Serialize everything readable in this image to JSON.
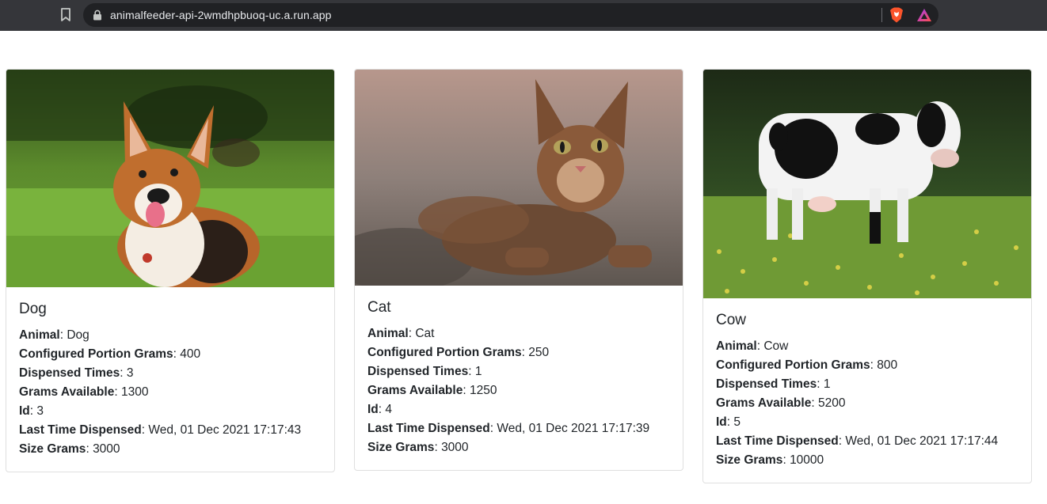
{
  "browser": {
    "url": "animalfeeder-api-2wmdhpbuoq-uc.a.run.app",
    "icons": [
      "bookmark-icon",
      "lock-icon",
      "brave-shield-icon",
      "brave-rewards-icon"
    ]
  },
  "labels": {
    "animal": "Animal",
    "portion": "Configured Portion Grams",
    "dispensed": "Dispensed Times",
    "available": "Grams Available",
    "id": "Id",
    "last": "Last Time Dispensed",
    "size": "Size Grams"
  },
  "cards": [
    {
      "title": "Dog",
      "image": "corgi-dog-photo",
      "animal": "Dog",
      "portion": "400",
      "dispensed": "3",
      "available": "1300",
      "id": "3",
      "last": "Wed, 01 Dec 2021 17:17:43",
      "size": "3000"
    },
    {
      "title": "Cat",
      "image": "tabby-cat-photo",
      "animal": "Cat",
      "portion": "250",
      "dispensed": "1",
      "available": "1250",
      "id": "4",
      "last": "Wed, 01 Dec 2021 17:17:39",
      "size": "3000"
    },
    {
      "title": "Cow",
      "image": "holstein-cow-photo",
      "animal": "Cow",
      "portion": "800",
      "dispensed": "1",
      "available": "5200",
      "id": "5",
      "last": "Wed, 01 Dec 2021 17:17:44",
      "size": "10000"
    }
  ]
}
